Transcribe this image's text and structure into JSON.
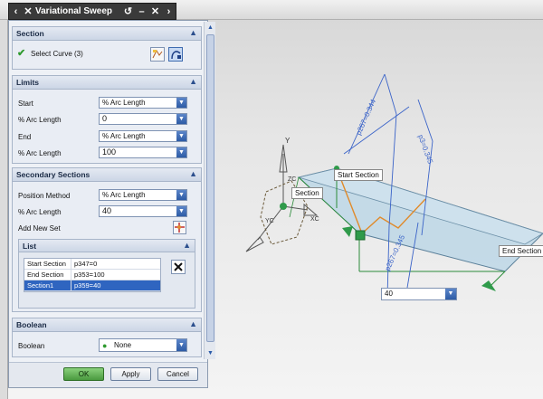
{
  "titlebar": {
    "back": "‹",
    "forward": "›",
    "title": "Variational Sweep",
    "reset": "↺",
    "minimize": "–",
    "close": "✕"
  },
  "section": {
    "title": "Section",
    "select_curve": "Select Curve (3)"
  },
  "limits": {
    "title": "Limits",
    "start_label": "Start",
    "start_value": "% Arc Length",
    "start_pct_label": "% Arc Length",
    "start_pct_value": "0",
    "end_label": "End",
    "end_value": "% Arc Length",
    "end_pct_label": "% Arc Length",
    "end_pct_value": "100"
  },
  "secondary": {
    "title": "Secondary Sections",
    "position_method_label": "Position Method",
    "position_method_value": "% Arc Length",
    "arc_length_label": "% Arc Length",
    "arc_length_value": "40",
    "add_new_set_label": "Add New Set",
    "list_title": "List",
    "list_rows": [
      {
        "name": "Start Section",
        "value": "p347=0"
      },
      {
        "name": "End Section",
        "value": "p353=100"
      },
      {
        "name": "Section1",
        "value": "p359=40"
      }
    ]
  },
  "boolean": {
    "title": "Boolean",
    "label": "Boolean",
    "value": "None"
  },
  "buttons": {
    "ok": "OK",
    "apply": "Apply",
    "cancel": "Cancel"
  },
  "viewport": {
    "start_section_label": "Start Section",
    "section_label": "Section",
    "end_section_label": "End Section",
    "arc_input_value": "40",
    "dim1": "p267=0.344",
    "dim2": "p3=0.345",
    "dim3": "p267=0.345",
    "axis_y": "Y",
    "axis_x": "X",
    "axis_zc": "ZC",
    "axis_yc": "YC",
    "axis_xc": "XC"
  },
  "colors": {
    "dialog_bg": "#eef1f6",
    "accent_blue": "#2f65c0",
    "ok_green": "#4a9a3f",
    "sweep_fill": "#b7d4e6"
  }
}
